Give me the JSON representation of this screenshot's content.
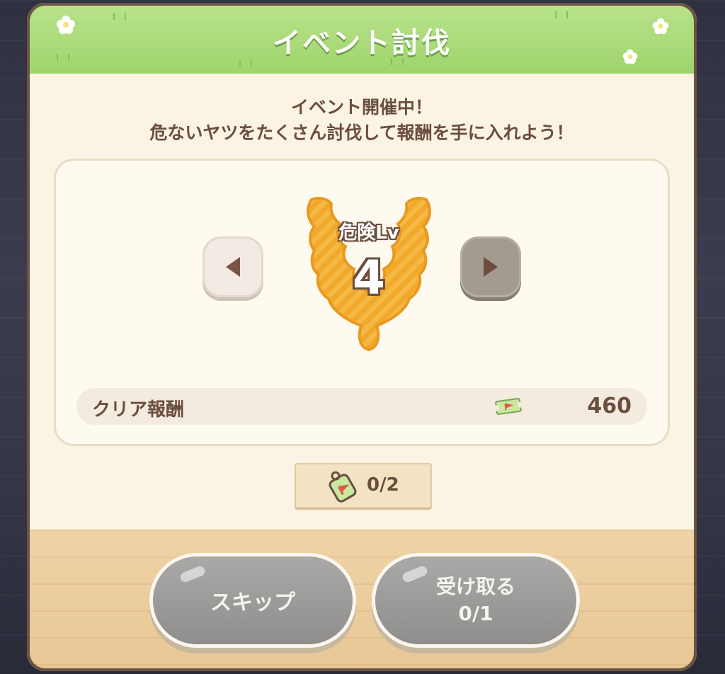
{
  "dialog": {
    "title": "イベント討伐",
    "subtitle_line1": "イベント開催中！",
    "subtitle_line2": "危ないヤツをたくさん討伐して報酬を手に入れよう！"
  },
  "danger": {
    "label": "危険Lv",
    "level": "4",
    "prev_icon": "triangle-left-icon",
    "next_icon": "triangle-right-icon"
  },
  "reward": {
    "label": "クリア報酬",
    "icon": "ticket-icon",
    "value": "460"
  },
  "attempts": {
    "icon": "tag-icon",
    "text": "0/2"
  },
  "buttons": {
    "skip_label": "スキップ",
    "receive_label": "受け取る",
    "receive_count": "0/1"
  },
  "colors": {
    "header_green": "#9fd46c",
    "text_brown": "#6b4e3e",
    "badge_orange": "#f2a92b",
    "button_gray": "#9a9997"
  }
}
